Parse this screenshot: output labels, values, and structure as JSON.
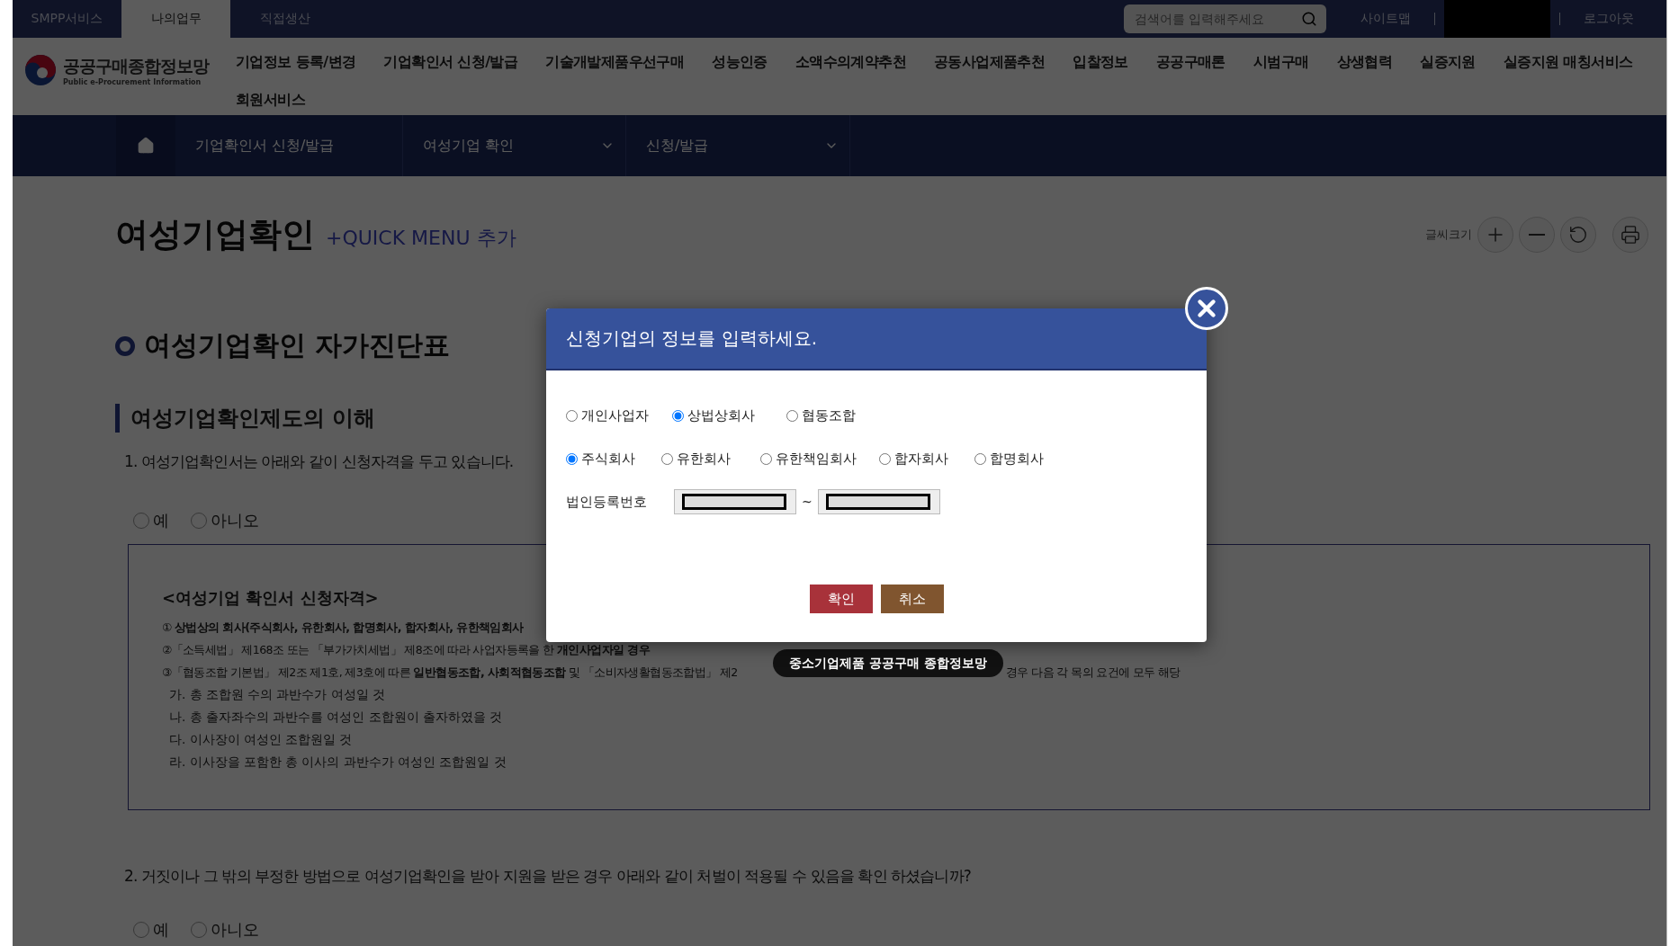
{
  "top_bar": {
    "tabs": [
      {
        "label": "SMPP서비스",
        "selected": false
      },
      {
        "label": "나의업무",
        "selected": true
      },
      {
        "label": "직접생산",
        "selected": false
      }
    ],
    "search": {
      "placeholder": "검색어를 입력해주세요"
    },
    "links": [
      "사이트맵",
      "로그아웃"
    ]
  },
  "header": {
    "logo": {
      "title": "공공구매종합정보망",
      "subtitle": "Public e-Procurement Information"
    },
    "menu": [
      "기업정보 등록/변경",
      "기업확인서 신청/발급",
      "기술개발제품우선구매",
      "성능인증",
      "소액수의계약추천",
      "공동사업제품추천",
      "입찰정보",
      "공공구매론",
      "시범구매",
      "상생협력",
      "실증지원",
      "실증지원 매칭서비스",
      "회원서비스"
    ]
  },
  "breadcrumb": [
    {
      "label": "기업확인서 신청/발급",
      "dropdown": false
    },
    {
      "label": "여성기업 확인",
      "dropdown": true
    },
    {
      "label": "신청/발급",
      "dropdown": true
    }
  ],
  "page": {
    "title": "여성기업확인",
    "quick_menu": "+QUICK MENU 추가",
    "font_size_label": "글씨크기"
  },
  "section_title": "여성기업확인 자가진단표",
  "subsection_title": "여성기업확인제도의 이해",
  "questions": [
    {
      "text": "1. 여성기업확인서는 아래와 같이 신청자격을 두고 있습니다.",
      "options": [
        {
          "label": "예",
          "selected": false
        },
        {
          "label": "아니오",
          "selected": false
        }
      ]
    },
    {
      "text": "2. 거짓이나 그 밖의 부정한 방법으로 여성기업확인을 받아 지원을 받은 경우 아래와 같이 처벌이 적용될 수 있음을 확인 하셨습니까?",
      "options": [
        {
          "label": "예",
          "selected": false
        },
        {
          "label": "아니오",
          "selected": false
        }
      ]
    }
  ],
  "qualification": {
    "heading": "<여성기업 확인서 신청자격>",
    "items": [
      {
        "text": "① **상법상의 회사(주식회사, 유한회사, 합명회사, 합자회사, 유한책임회사**"
      },
      {
        "text": "②「소득세법」 제168조 또는 「부가가치세법」 제8조에 따라 사업자등록을 한 **개인사업자일 경우**"
      },
      {
        "text": "③「협동조합 기본법」 제2조 제1호, 제3호에 따른 **일반협동조합, 사회적협동조합** 및 「소비자생활협동조합법」 제2",
        "continuation": "경우 다음 각 목의 요건에 모두 해당"
      }
    ],
    "sub_items": [
      "가. 총 조합원 수의 과반수가 여성일 것",
      "나. 총 출자좌수의 과반수를 여성인 조합원이 출자하였을 것",
      "다. 이사장이 여성인 조합원일 것",
      "라. 이사장을 포함한 총 이사의 과반수가 여성인 조합원일 것"
    ]
  },
  "dialog": {
    "title": "신청기업의 정보를 입력하세요.",
    "radio_groups": [
      [
        {
          "label": "개인사업자",
          "selected": false
        },
        {
          "label": "상법상회사",
          "selected": true
        },
        {
          "label": "협동조합",
          "selected": false
        }
      ],
      [
        {
          "label": "주식회사",
          "selected": true
        },
        {
          "label": "유한회사",
          "selected": false
        },
        {
          "label": "유한책임회사",
          "selected": false
        },
        {
          "label": "합자회사",
          "selected": false
        },
        {
          "label": "합명회사",
          "selected": false
        }
      ]
    ],
    "field_label": "법인등록번호",
    "separator": "~",
    "buttons": [
      {
        "label": "확인",
        "kind": "confirm"
      },
      {
        "label": "취소",
        "kind": "cancel"
      }
    ]
  },
  "tooltip": "중소기업제품 공공구매 종합정보망"
}
